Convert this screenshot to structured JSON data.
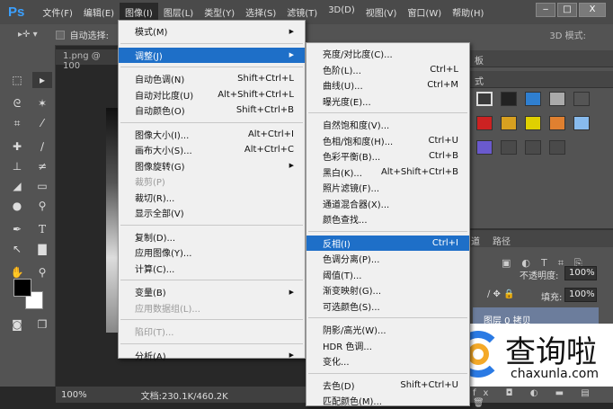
{
  "app": {
    "logo": "Ps"
  },
  "menubar": [
    "文件(F)",
    "编辑(E)",
    "图像(I)",
    "图层(L)",
    "类型(Y)",
    "选择(S)",
    "滤镜(T)",
    "3D(D)",
    "视图(V)",
    "窗口(W)",
    "帮助(H)"
  ],
  "window_controls": {
    "minimize": "‒",
    "maximize": "□",
    "close": "X"
  },
  "options": {
    "auto_select": "自动选择:",
    "mode3d": "3D 模式:"
  },
  "document": {
    "tab": "1.png @ 100",
    "zoom": "100%",
    "doc_size": "文档:230.1K/460.2K"
  },
  "image_menu": [
    {
      "label": "模式(M)",
      "sub": true
    },
    {
      "sep": true
    },
    {
      "label": "调整(J)",
      "sub": true,
      "hl": true
    },
    {
      "sep": true
    },
    {
      "label": "自动色调(N)",
      "key": "Shift+Ctrl+L"
    },
    {
      "label": "自动对比度(U)",
      "key": "Alt+Shift+Ctrl+L"
    },
    {
      "label": "自动颜色(O)",
      "key": "Shift+Ctrl+B"
    },
    {
      "sep": true
    },
    {
      "label": "图像大小(I)...",
      "key": "Alt+Ctrl+I"
    },
    {
      "label": "画布大小(S)...",
      "key": "Alt+Ctrl+C"
    },
    {
      "label": "图像旋转(G)",
      "sub": true
    },
    {
      "label": "裁剪(P)",
      "dis": true
    },
    {
      "label": "裁切(R)..."
    },
    {
      "label": "显示全部(V)"
    },
    {
      "sep": true
    },
    {
      "label": "复制(D)..."
    },
    {
      "label": "应用图像(Y)..."
    },
    {
      "label": "计算(C)..."
    },
    {
      "sep": true
    },
    {
      "label": "变量(B)",
      "sub": true
    },
    {
      "label": "应用数据组(L)...",
      "dis": true
    },
    {
      "sep": true
    },
    {
      "label": "陷印(T)...",
      "dis": true
    },
    {
      "sep": true
    },
    {
      "label": "分析(A)",
      "sub": true
    }
  ],
  "adjust_menu": [
    {
      "label": "亮度/对比度(C)..."
    },
    {
      "label": "色阶(L)...",
      "key": "Ctrl+L"
    },
    {
      "label": "曲线(U)...",
      "key": "Ctrl+M"
    },
    {
      "label": "曝光度(E)..."
    },
    {
      "sep": true
    },
    {
      "label": "自然饱和度(V)..."
    },
    {
      "label": "色相/饱和度(H)...",
      "key": "Ctrl+U"
    },
    {
      "label": "色彩平衡(B)...",
      "key": "Ctrl+B"
    },
    {
      "label": "黑白(K)...",
      "key": "Alt+Shift+Ctrl+B"
    },
    {
      "label": "照片滤镜(F)..."
    },
    {
      "label": "通道混合器(X)..."
    },
    {
      "label": "颜色查找..."
    },
    {
      "sep": true
    },
    {
      "label": "反相(I)",
      "key": "Ctrl+I",
      "hl": true
    },
    {
      "label": "色调分离(P)..."
    },
    {
      "label": "阈值(T)..."
    },
    {
      "label": "渐变映射(G)..."
    },
    {
      "label": "可选颜色(S)..."
    },
    {
      "sep": true
    },
    {
      "label": "阴影/高光(W)..."
    },
    {
      "label": "HDR 色调..."
    },
    {
      "label": "变化..."
    },
    {
      "sep": true
    },
    {
      "label": "去色(D)",
      "key": "Shift+Ctrl+U"
    },
    {
      "label": "匹配颜色(M)..."
    }
  ],
  "right_panel": {
    "tab1": "板",
    "tab2": "式",
    "paths_tab_a": "道",
    "paths_tab_b": "路径",
    "opacity_label": "不透明度:",
    "opacity": "100%",
    "fill_label": "填充:",
    "fill": "100%",
    "layer_name": "图层 0 拷贝"
  },
  "styles_colors": [
    "#3a3a3a",
    "#222222",
    "#2f7fd0",
    "#aaaaaa",
    "#555555",
    "#cc2222",
    "#d8a020",
    "#e0d000",
    "#e08030",
    "#88bbee",
    "#6a5acd",
    "#4a4a4a",
    "#4a4a4a",
    "#4a4a4a"
  ],
  "watermark": {
    "brand": "查询啦",
    "url": "chaxunla.com"
  }
}
